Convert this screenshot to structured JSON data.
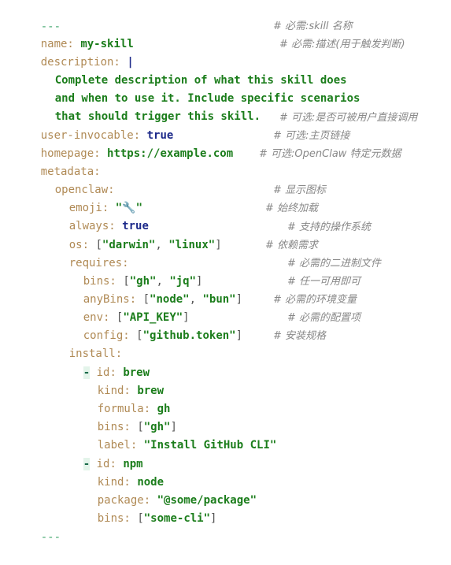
{
  "yaml": {
    "fence_open": "---",
    "fence_close": "---",
    "colors": {
      "key": "#b08a55",
      "string_value": "#1b7d1b",
      "boolean": "#1d2a8a",
      "comment": "#888888",
      "fence": "#3da56b"
    },
    "name": {
      "key": "name:",
      "value": "my-skill",
      "comment": "# 必需:skill 名称"
    },
    "description": {
      "key": "description:",
      "indicator": "|",
      "comment": "# 必需:描述(用于触发判断)",
      "lines": [
        "Complete description of what this skill does",
        "and when to use it. Include specific scenarios",
        "that should trigger this skill."
      ]
    },
    "user_invocable": {
      "key": "user-invocable:",
      "value": "true",
      "comment": "# 可选:是否可被用户直接调用"
    },
    "homepage": {
      "key": "homepage:",
      "value": "https://example.com",
      "comment": "# 可选:主页链接"
    },
    "metadata": {
      "key": "metadata:",
      "comment": "# 可选:OpenClaw 特定元数据",
      "openclaw": {
        "key": "openclaw:",
        "emoji": {
          "key": "emoji:",
          "value": "🔧",
          "comment": "# 显示图标"
        },
        "always": {
          "key": "always:",
          "value": "true",
          "comment": "# 始终加载"
        },
        "os": {
          "key": "os:",
          "items": [
            "\"darwin\"",
            "\"linux\""
          ],
          "comment": "# 支持的操作系统"
        },
        "requires": {
          "key": "requires:",
          "comment": "# 依赖需求",
          "bins": {
            "key": "bins:",
            "items": [
              "\"gh\"",
              "\"jq\""
            ],
            "comment": "# 必需的二进制文件"
          },
          "anyBins": {
            "key": "anyBins:",
            "items": [
              "\"node\"",
              "\"bun\""
            ],
            "comment": "# 任一可用即可"
          },
          "env": {
            "key": "env:",
            "items": [
              "\"API_KEY\""
            ],
            "comment": "# 必需的环境变量"
          },
          "config": {
            "key": "config:",
            "items": [
              "\"github.token\""
            ],
            "comment": "# 必需的配置项"
          }
        },
        "install": {
          "key": "install:",
          "comment": "# 安装规格",
          "entries": [
            {
              "dash": "-",
              "id_key": "id:",
              "id": "brew",
              "kind_key": "kind:",
              "kind": "brew",
              "formula_key": "formula:",
              "formula": "gh",
              "bins_key": "bins:",
              "bins": "\"gh\"",
              "label_key": "label:",
              "label": "\"Install GitHub CLI\""
            },
            {
              "dash": "-",
              "id_key": "id:",
              "id": "npm",
              "kind_key": "kind:",
              "kind": "node",
              "package_key": "package:",
              "package": "\"@some/package\"",
              "bins_key": "bins:",
              "bins": "\"some-cli\""
            }
          ]
        }
      }
    }
  }
}
